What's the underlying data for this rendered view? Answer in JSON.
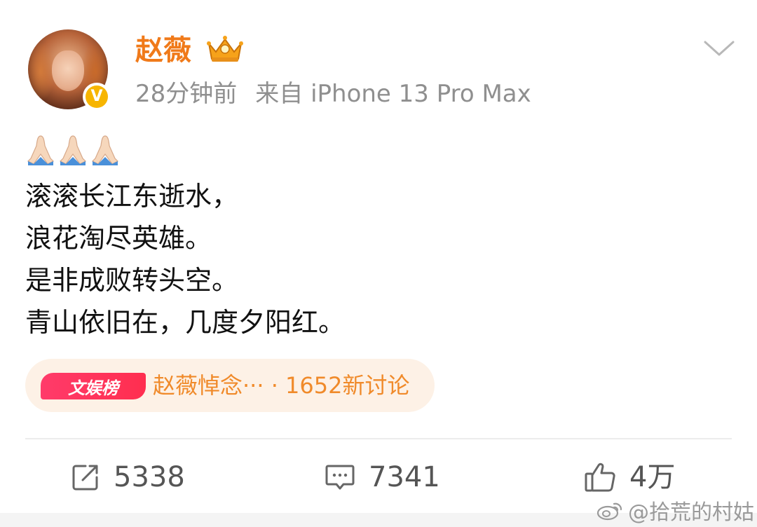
{
  "post": {
    "username": "赵薇",
    "meta_time": "28分钟前",
    "meta_source": "来自 iPhone 13 Pro Max",
    "verified_badge": "V",
    "emoji": [
      "🙏🏻",
      "🙏🏻",
      "🙏🏻"
    ],
    "lines": [
      "滚滚长江东逝水，",
      "浪花淘尽英雄。",
      "是非成败转头空。",
      "青山依旧在，几度夕阳红。"
    ],
    "topic": {
      "tag": "文娱榜",
      "text": "赵薇悼念··· · 1652新讨论"
    }
  },
  "actions": {
    "repost_count": "5338",
    "comment_count": "7341",
    "like_count": "4万"
  },
  "watermark": "@拾荒的村姑",
  "colors": {
    "username": "#f07a1a",
    "topic_bg": "#fdf1e6",
    "topic_text": "#f08a2a",
    "tag_bg": "#ff2e4f",
    "verified": "#f7b500"
  },
  "icons": [
    "crown-icon",
    "chevron-down-icon",
    "pray-emoji-icon",
    "repost-icon",
    "comment-icon",
    "like-icon",
    "weibo-icon"
  ]
}
